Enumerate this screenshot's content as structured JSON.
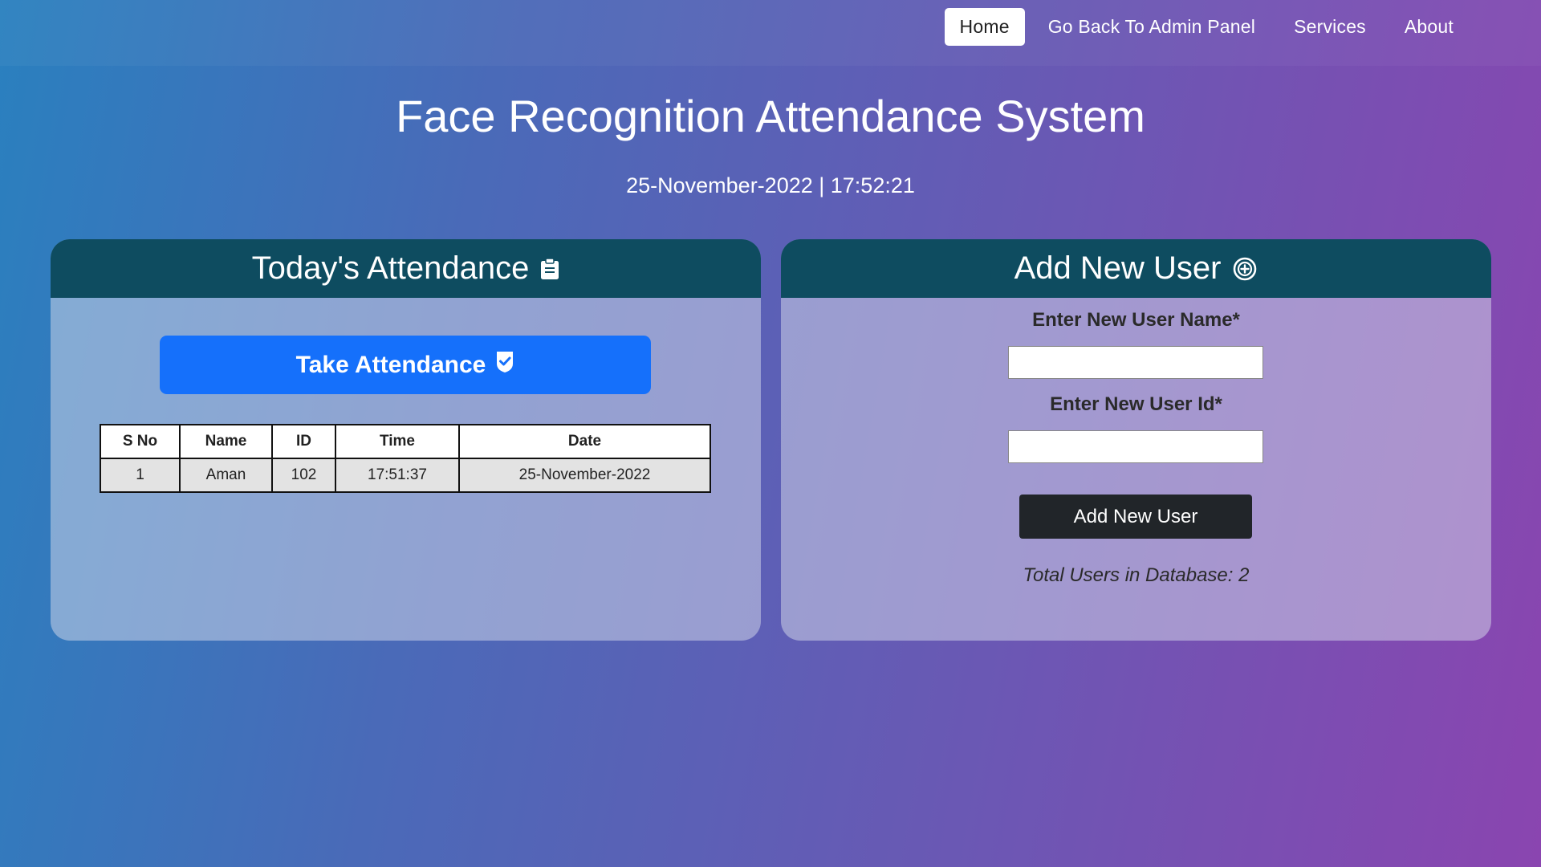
{
  "nav": {
    "items": [
      {
        "label": "Home",
        "active": true
      },
      {
        "label": "Go Back To Admin Panel",
        "active": false
      },
      {
        "label": "Services",
        "active": false
      },
      {
        "label": "About",
        "active": false
      }
    ]
  },
  "page": {
    "title": "Face Recognition Attendance System",
    "datetime": "25-November-2022 | 17:52:21"
  },
  "attendance_card": {
    "title": "Today's Attendance",
    "icon": "clipboard-icon",
    "take_button_label": "Take Attendance",
    "take_button_icon": "check-shield-icon",
    "table": {
      "headers": [
        "S No",
        "Name",
        "ID",
        "Time",
        "Date"
      ],
      "rows": [
        [
          "1",
          "Aman",
          "102",
          "17:51:37",
          "25-November-2022"
        ]
      ]
    }
  },
  "add_user_card": {
    "title": "Add New User",
    "icon": "plus-circle-icon",
    "name_label": "Enter New User Name*",
    "name_value": "",
    "id_label": "Enter New User Id*",
    "id_value": "",
    "button_label": "Add New User",
    "total_users_text": "Total Users in Database: 2"
  },
  "colors": {
    "card_header": "#0e4c60",
    "primary_button": "#1570fb",
    "dark_button": "#212529"
  }
}
